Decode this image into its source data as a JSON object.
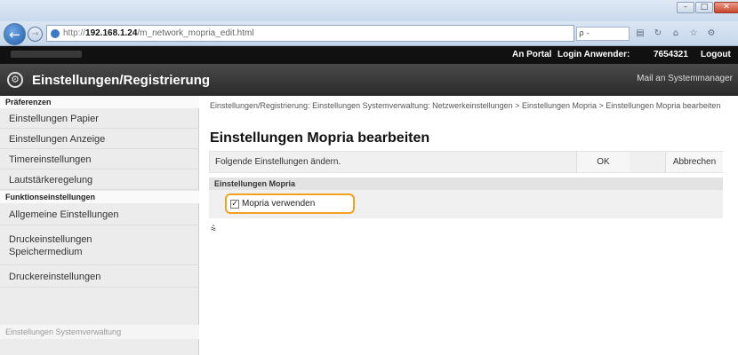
{
  "browser": {
    "url_scheme": "http://",
    "url_host": "192.168.1.24",
    "url_path": "/m_network_mopria_edit.html",
    "search_placeholder": "ρ -",
    "window_controls": [
      "–",
      "□",
      "✕"
    ]
  },
  "header": {
    "portal": "An Portal",
    "login_label": "Login Anwender:",
    "login_id": "7654321",
    "logout": "Logout"
  },
  "banner": {
    "title": "Einstellungen/Registrierung",
    "mail": "Mail an Systemmanager"
  },
  "sidebar": {
    "group1": "Präferenzen",
    "items1": [
      "Einstellungen Papier",
      "Einstellungen Anzeige",
      "Timereinstellungen",
      "Lautstärkeregelung"
    ],
    "group2": "Funktionseinstellungen",
    "items2": [
      "Allgemeine Einstellungen",
      "Druckeinstellungen\nSpeichermedium",
      "Druckereinstellungen"
    ],
    "group3": "Einstellungen Systemverwaltung"
  },
  "main": {
    "breadcrumb": "Einstellungen/Registrierung: Einstellungen Systemverwaltung: Netzwerkeinstellungen > Einstellungen Mopria > Einstellungen Mopria bearbeiten",
    "title": "Einstellungen Mopria bearbeiten",
    "info": "Folgende Einstellungen ändern.",
    "ok": "OK",
    "cancel": "Abbrechen",
    "section": "Einstellungen Mopria",
    "checkbox_label": "Mopria verwenden",
    "checkbox_checked": true,
    "to_top": "⩯"
  }
}
